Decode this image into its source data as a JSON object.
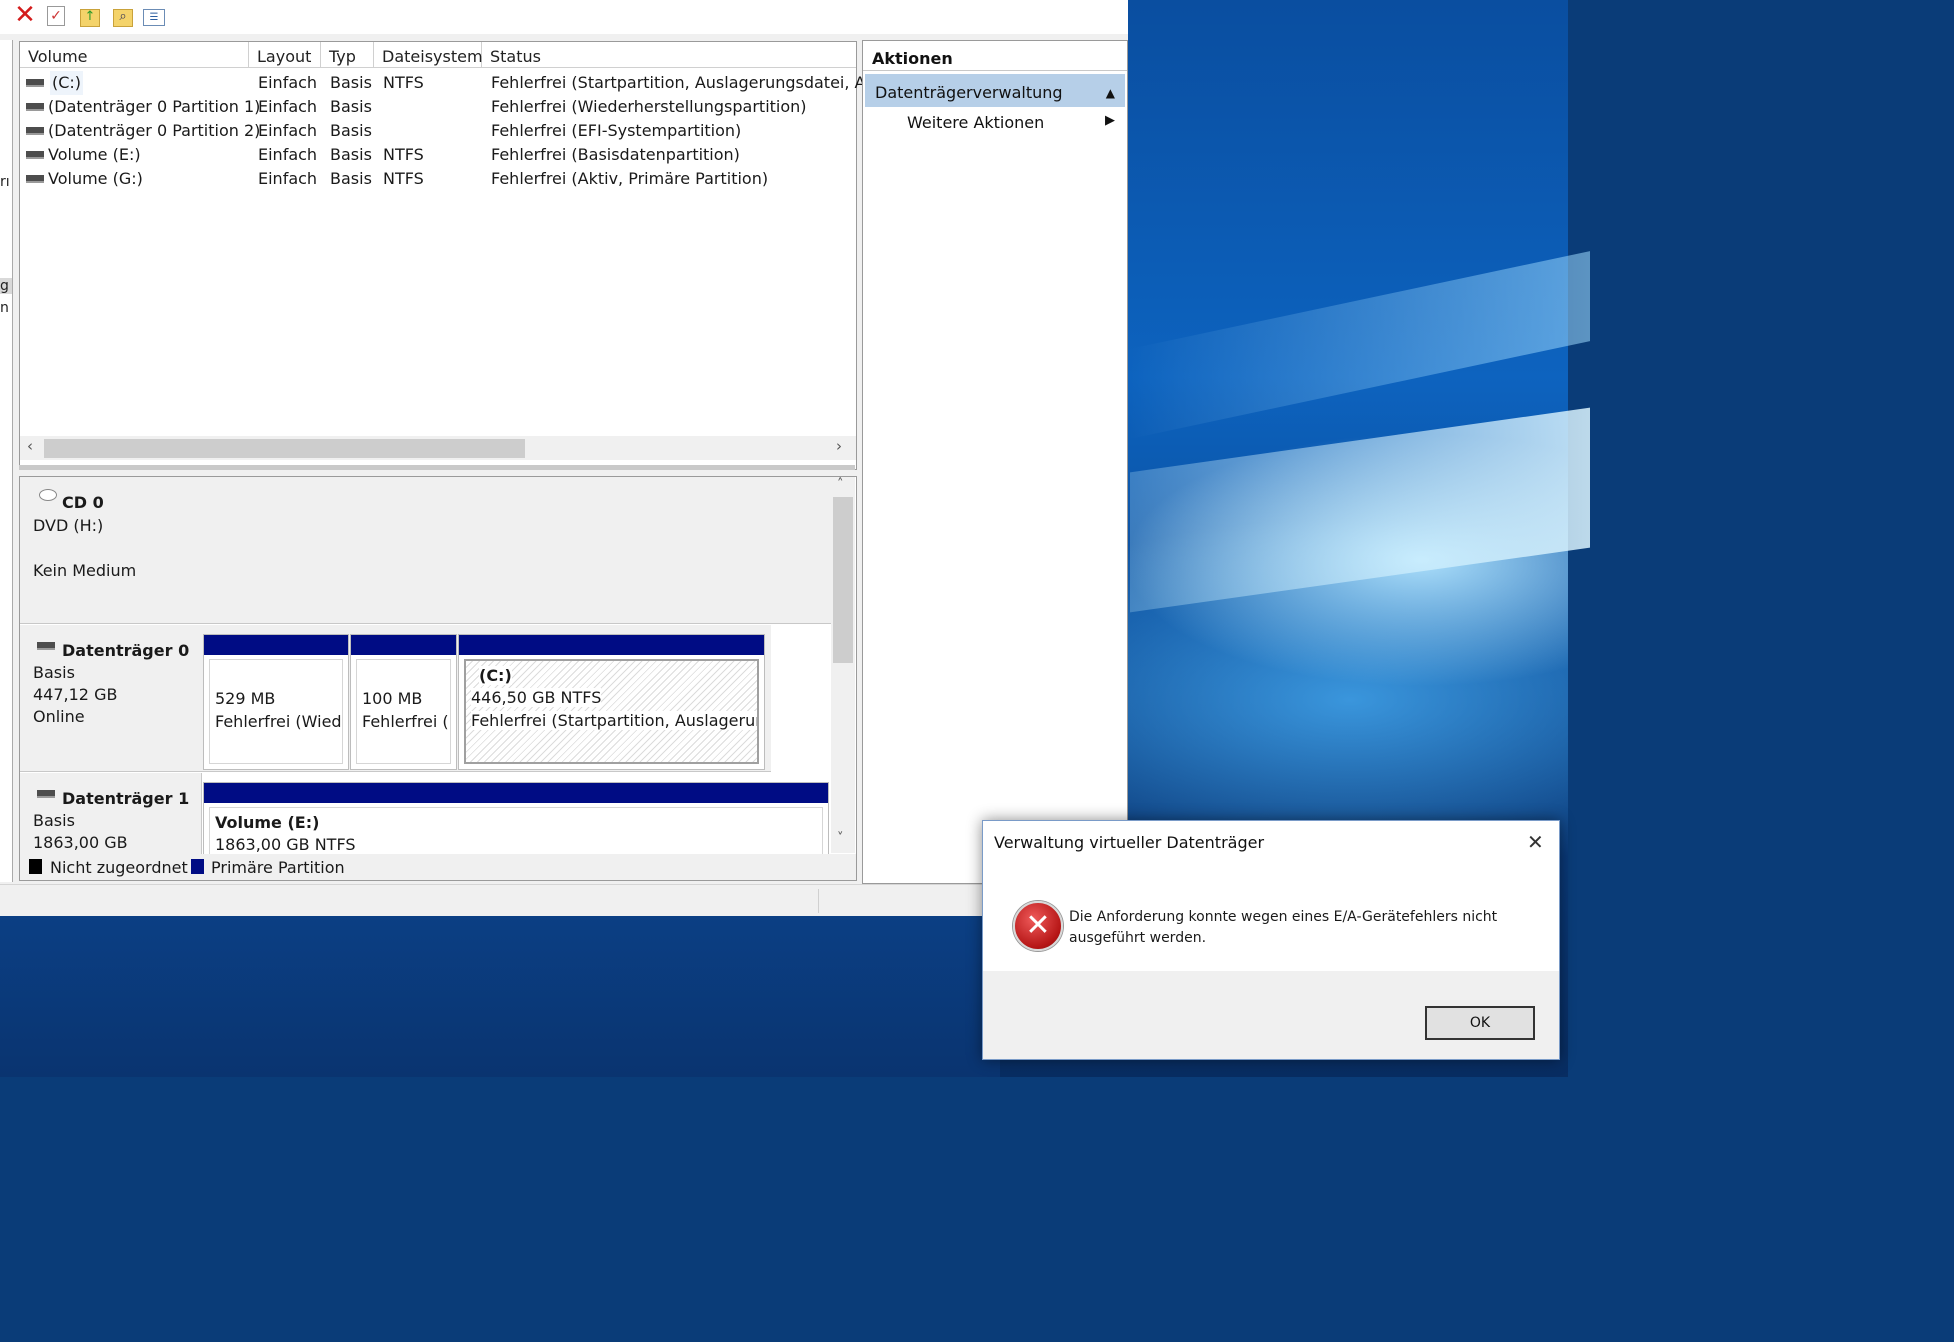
{
  "toolbar": {
    "icons": [
      "delete-icon",
      "properties-icon",
      "up-folder-icon",
      "search-folder-icon",
      "list-view-icon"
    ]
  },
  "volume_list": {
    "columns": [
      "Volume",
      "Layout",
      "Typ",
      "Dateisystem",
      "Status"
    ],
    "rows": [
      {
        "volume": "(C:)",
        "layout": "Einfach",
        "typ": "Basis",
        "fs": "NTFS",
        "status": "Fehlerfrei (Startpartition, Auslagerungsdatei, Abst"
      },
      {
        "volume": "(Datenträger 0 Partition 1)",
        "layout": "Einfach",
        "typ": "Basis",
        "fs": "",
        "status": "Fehlerfrei (Wiederherstellungspartition)"
      },
      {
        "volume": "(Datenträger 0 Partition 2)",
        "layout": "Einfach",
        "typ": "Basis",
        "fs": "",
        "status": "Fehlerfrei (EFI-Systempartition)"
      },
      {
        "volume": "Volume (E:)",
        "layout": "Einfach",
        "typ": "Basis",
        "fs": "NTFS",
        "status": "Fehlerfrei (Basisdatenpartition)"
      },
      {
        "volume": "Volume (G:)",
        "layout": "Einfach",
        "typ": "Basis",
        "fs": "NTFS",
        "status": "Fehlerfrei (Aktiv, Primäre Partition)"
      }
    ]
  },
  "disks": {
    "cd0": {
      "name": "CD 0",
      "line1": "DVD (H:)",
      "line2": "Kein Medium"
    },
    "disk0": {
      "name": "Datenträger 0",
      "type": "Basis",
      "size": "447,12 GB",
      "state": "Online",
      "partitions": [
        {
          "title": "",
          "size": "529 MB",
          "status": "Fehlerfrei (Wiede"
        },
        {
          "title": "",
          "size": "100 MB",
          "status": "Fehlerfrei (E"
        },
        {
          "title": "(C:)",
          "size": "446,50 GB NTFS",
          "status": "Fehlerfrei (Startpartition, Auslagerungs"
        }
      ]
    },
    "disk1": {
      "name": "Datenträger 1",
      "type": "Basis",
      "size": "1863,00 GB",
      "partition": {
        "title": "Volume  (E:)",
        "size": "1863,00 GB NTFS"
      }
    }
  },
  "legend": {
    "unallocated": "Nicht zugeordnet",
    "primary": "Primäre Partition"
  },
  "actions": {
    "header": "Aktionen",
    "selected": "Datenträgerverwaltung",
    "more": "Weitere Aktionen"
  },
  "dialog": {
    "title": "Verwaltung virtueller Datenträger",
    "message": "Die Anforderung konnte wegen eines E/A-Gerätefehlers nicht ausgeführt werden.",
    "ok_label": "OK"
  },
  "left_strip": [
    "rı",
    "g",
    "n"
  ],
  "colors": {
    "primary_partition": "#000c84",
    "selection": "#b6cfe8",
    "error": "#c41a1a"
  }
}
